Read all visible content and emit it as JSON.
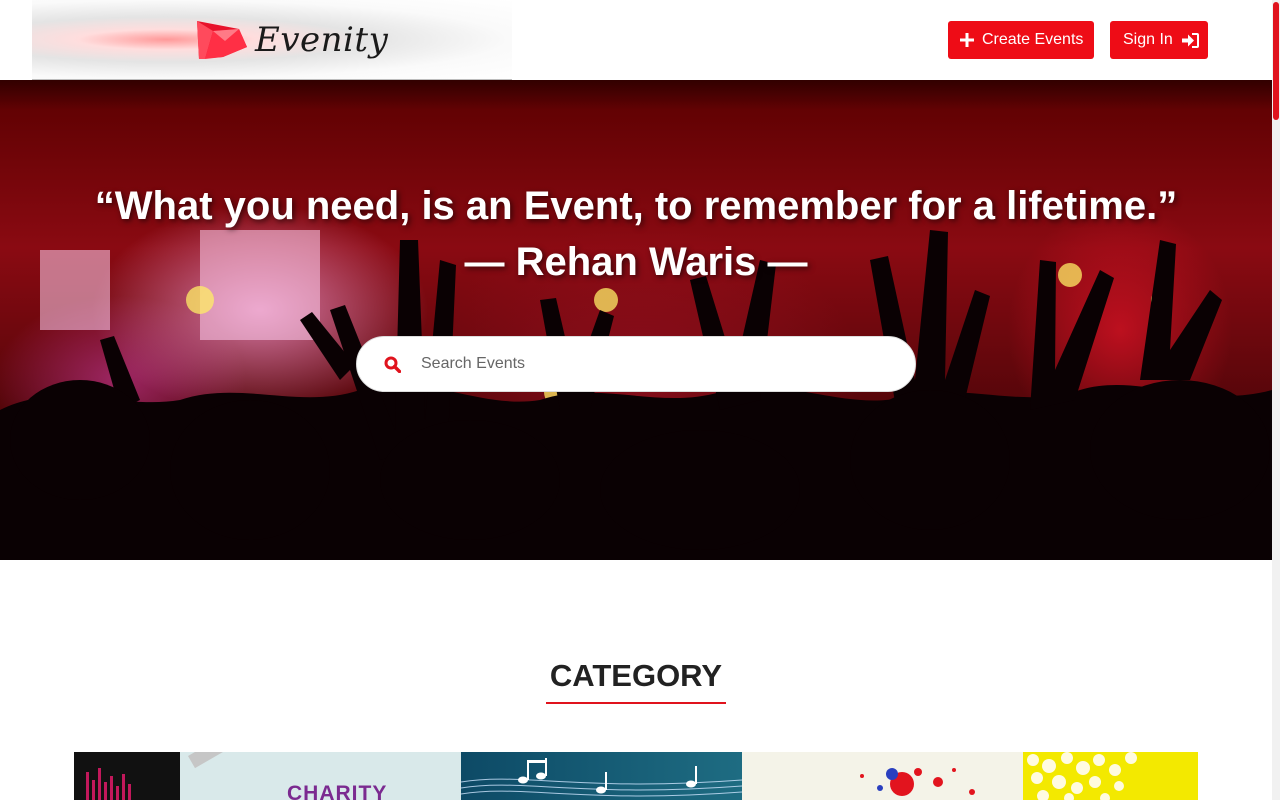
{
  "header": {
    "brand_name": "Evenity",
    "create_label": "Create Events",
    "signin_label": "Sign In"
  },
  "hero": {
    "quote": "“What you need, is an Event, to remember for a lifetime.”",
    "author": "— Rehan Waris —",
    "search_placeholder": "Search Events"
  },
  "category": {
    "title": "CATEGORY",
    "cards": [
      {
        "name": "music-bars",
        "label": ""
      },
      {
        "name": "charity",
        "label": "CHARITY"
      },
      {
        "name": "music-notes",
        "label": ""
      },
      {
        "name": "paint-splash",
        "label": ""
      },
      {
        "name": "popcorn",
        "label": ""
      }
    ]
  },
  "colors": {
    "accent": "#ee0c16",
    "hero_dark": "#5a0000"
  }
}
